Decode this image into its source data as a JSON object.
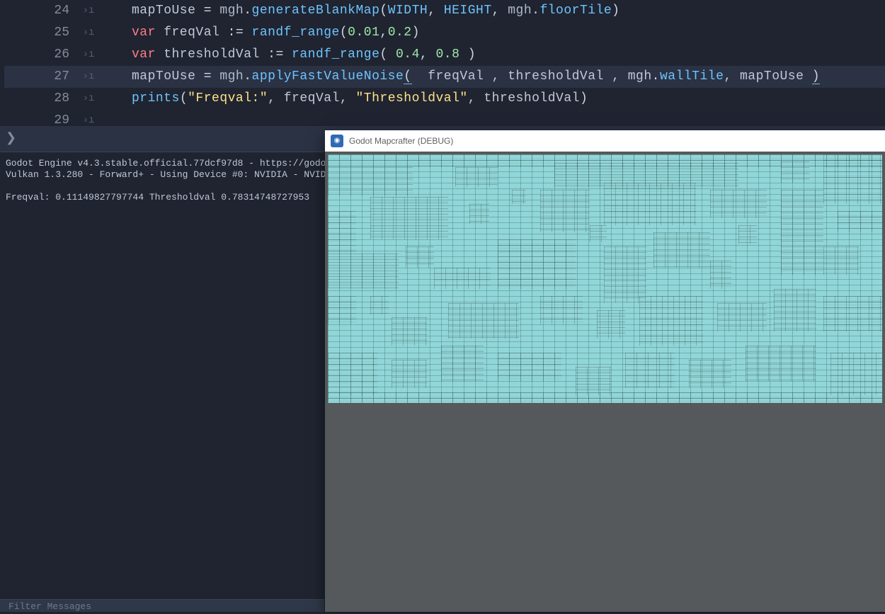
{
  "editor": {
    "lines": [
      {
        "n": "24"
      },
      {
        "n": "25"
      },
      {
        "n": "26"
      },
      {
        "n": "27"
      },
      {
        "n": "28"
      },
      {
        "n": "29"
      }
    ],
    "l24_a": "mapToUse ",
    "l24_eq": "= ",
    "l24_mgh": "mgh",
    "l24_dot": ".",
    "l24_fn": "generateBlankMap",
    "l24_op": "(",
    "l24_w": "WIDTH",
    "l24_c1": ", ",
    "l24_h": "HEIGHT",
    "l24_c2": ", ",
    "l24_mgh2": "mgh",
    "l24_dot2": ".",
    "l24_fl": "floorTile",
    "l24_cp": ")",
    "l25_var": "var",
    "l25_name": " freqVal ",
    "l25_ass": ":= ",
    "l25_fn": "randf_range",
    "l25_op": "(",
    "l25_n1": "0.01",
    "l25_c": ",",
    "l25_n2": "0.2",
    "l25_cp": ")",
    "l26_var": "var",
    "l26_name": " thresholdVal ",
    "l26_ass": ":= ",
    "l26_fn": "randf_range",
    "l26_op": "( ",
    "l26_n1": "0.4",
    "l26_c": ", ",
    "l26_n2": "0.8",
    "l26_cp": " )",
    "l27_a": "mapToUse ",
    "l27_eq": "= ",
    "l27_mgh": "mgh",
    "l27_dot": ".",
    "l27_fn": "applyFastValueNoise",
    "l27_op": "(",
    "l27_args": "  freqVal , thresholdVal , mgh",
    "l27_dot2": ".",
    "l27_wall": "wallTile",
    "l27_c2": ", mapToUse ",
    "l27_cp": ")",
    "l28_fn": "prints",
    "l28_op": "(",
    "l28_s1": "\"Freqval:\"",
    "l28_c1": ", freqVal, ",
    "l28_s2": "\"Thresholdval\"",
    "l28_c2": ", thresholdVal",
    "l28_cp": ")"
  },
  "prompt_glyph": "❯",
  "console": {
    "l1": "Godot Engine v4.3.stable.official.77dcf97d8 - https://godo",
    "l2": "Vulkan 1.3.280 - Forward+ - Using Device #0: NVIDIA - NVID",
    "l3": " ",
    "l4": "Freqval: 0.11149827797744 Thresholdval 0.78314748727953"
  },
  "filter_placeholder": "Filter Messages",
  "game": {
    "title": "Godot Mapcrafter (DEBUG)",
    "icon_glyph": "◉"
  },
  "fold_glyph": "›ı"
}
